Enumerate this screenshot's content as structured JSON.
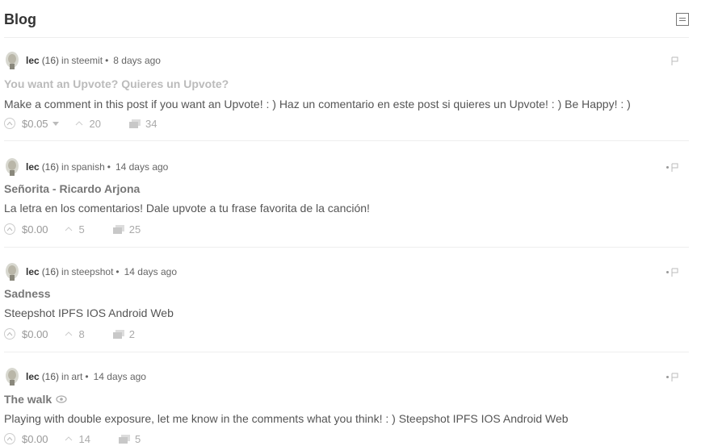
{
  "header": {
    "title": "Blog",
    "layout_icon": "list-layout-icon"
  },
  "posts": [
    {
      "author": "lec",
      "reputation": "(16)",
      "in_label": "in",
      "category": "steemit",
      "age": "8 days ago",
      "title": "You want an Upvote? Quieres un Upvote?",
      "title_faded": true,
      "body": "Make a comment in this post if you want an Upvote! : ) Haz un comentario en este post si quieres un Upvote! : ) Be Happy! : )",
      "payout": "$0.05",
      "has_payout_dropdown": true,
      "votes": "20",
      "comments": "34",
      "has_dot": false
    },
    {
      "author": "lec",
      "reputation": "(16)",
      "in_label": "in",
      "category": "spanish",
      "age": "14 days ago",
      "title": "Señorita - Ricardo Arjona",
      "title_faded": false,
      "body": "La letra en los comentarios! Dale upvote a tu frase favorita de la canción!",
      "payout": "$0.00",
      "has_payout_dropdown": false,
      "votes": "5",
      "comments": "25",
      "has_dot": true
    },
    {
      "author": "lec",
      "reputation": "(16)",
      "in_label": "in",
      "category": "steepshot",
      "age": "14 days ago",
      "title": "Sadness",
      "title_faded": false,
      "body": "Steepshot IPFS IOS Android Web",
      "payout": "$0.00",
      "has_payout_dropdown": false,
      "votes": "8",
      "comments": "2",
      "has_dot": true
    },
    {
      "author": "lec",
      "reputation": "(16)",
      "in_label": "in",
      "category": "art",
      "age": "14 days ago",
      "title": "The walk",
      "title_faded": false,
      "title_icon": "eye-icon",
      "body": "Playing with double exposure, let me know in the comments what you think! : ) Steepshot IPFS IOS Android Web",
      "payout": "$0.00",
      "has_payout_dropdown": false,
      "votes": "14",
      "comments": "5",
      "has_dot": true
    }
  ]
}
